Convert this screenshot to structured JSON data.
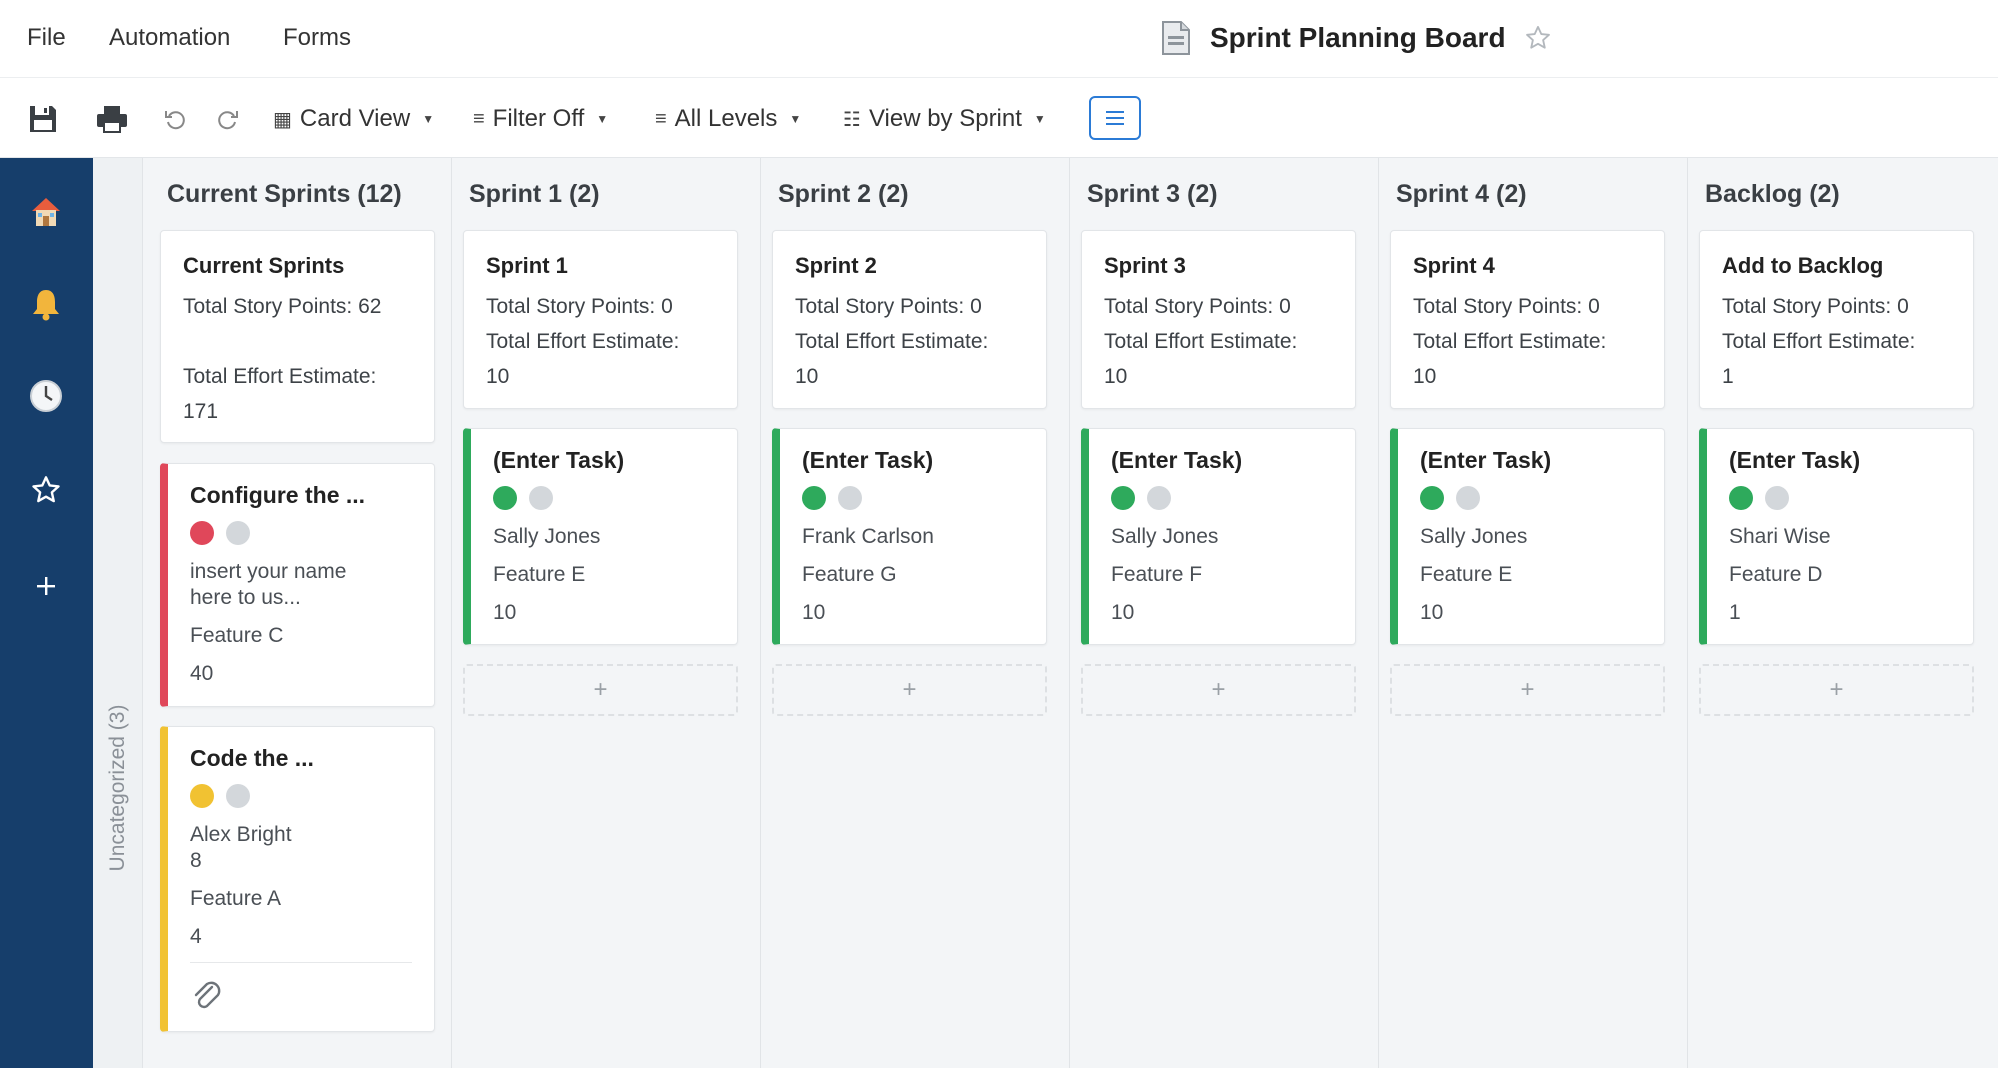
{
  "menu": {
    "file": "File",
    "automation": "Automation",
    "forms": "Forms"
  },
  "document": {
    "title": "Sprint Planning Board"
  },
  "toolbar": {
    "card_view": "Card View",
    "filter": "Filter Off",
    "levels": "All Levels",
    "view_by": "View by Sprint"
  },
  "board": {
    "uncategorized_label": "Uncategorized (3)"
  },
  "columns": [
    {
      "header": "Current Sprints (12)",
      "summary": {
        "title": "Current Sprints",
        "story_points": "Total Story Points: 62",
        "effort_label": "Total Effort Estimate:",
        "effort_value": "171"
      },
      "cards": [
        {
          "title": "Configure the ...",
          "status_color": "#e0475a",
          "line1": "insert your name here to us...",
          "line2": "Feature C",
          "line3": "40"
        },
        {
          "title": "Code the ...",
          "status_color": "#f1c232",
          "line1": "Alex Bright",
          "line1b": "8",
          "line2": "Feature A",
          "line3": "4",
          "has_attachment": true
        }
      ]
    },
    {
      "header": "Sprint 1 (2)",
      "summary": {
        "title": "Sprint 1",
        "story_points": "Total Story Points: 0",
        "effort_label": "Total Effort Estimate:",
        "effort_value": "10"
      },
      "cards": [
        {
          "title": "(Enter Task)",
          "status_color": "#2eaa5c",
          "line1": "Sally Jones",
          "line2": "Feature E",
          "line3": "10"
        }
      ],
      "add": "+"
    },
    {
      "header": "Sprint 2 (2)",
      "summary": {
        "title": "Sprint 2",
        "story_points": "Total Story Points: 0",
        "effort_label": "Total Effort Estimate:",
        "effort_value": "10"
      },
      "cards": [
        {
          "title": "(Enter Task)",
          "status_color": "#2eaa5c",
          "line1": "Frank Carlson",
          "line2": "Feature G",
          "line3": "10"
        }
      ],
      "add": "+"
    },
    {
      "header": "Sprint 3 (2)",
      "summary": {
        "title": "Sprint 3",
        "story_points": "Total Story Points: 0",
        "effort_label": "Total Effort Estimate:",
        "effort_value": "10"
      },
      "cards": [
        {
          "title": "(Enter Task)",
          "status_color": "#2eaa5c",
          "line1": "Sally Jones",
          "line2": "Feature F",
          "line3": "10"
        }
      ],
      "add": "+"
    },
    {
      "header": "Sprint 4 (2)",
      "summary": {
        "title": "Sprint 4",
        "story_points": "Total Story Points: 0",
        "effort_label": "Total Effort Estimate:",
        "effort_value": "10"
      },
      "cards": [
        {
          "title": "(Enter Task)",
          "status_color": "#2eaa5c",
          "line1": "Sally Jones",
          "line2": "Feature E",
          "line3": "10"
        }
      ],
      "add": "+"
    },
    {
      "header": "Backlog (2)",
      "summary": {
        "title": "Add to Backlog",
        "story_points": "Total Story Points: 0",
        "effort_label": "Total Effort Estimate:",
        "effort_value": "1"
      },
      "cards": [
        {
          "title": "(Enter Task)",
          "status_color": "#2eaa5c",
          "line1": "Shari Wise",
          "line2": "Feature D",
          "line3": "1"
        }
      ],
      "add": "+"
    }
  ],
  "colors": {
    "nav_bg": "#163e6b",
    "accent": "#2b7bd6",
    "green": "#2eaa5c",
    "red": "#e0475a",
    "yellow": "#f1c232"
  },
  "icons": {
    "toolbar": [
      "save-icon",
      "print-icon",
      "undo-icon",
      "redo-icon",
      "grid-icon",
      "filter-icon",
      "levels-icon",
      "view-by-icon",
      "list-toggle-icon"
    ],
    "nav": [
      "home-icon",
      "bell-icon",
      "clock-icon",
      "star-icon",
      "plus-icon"
    ]
  }
}
